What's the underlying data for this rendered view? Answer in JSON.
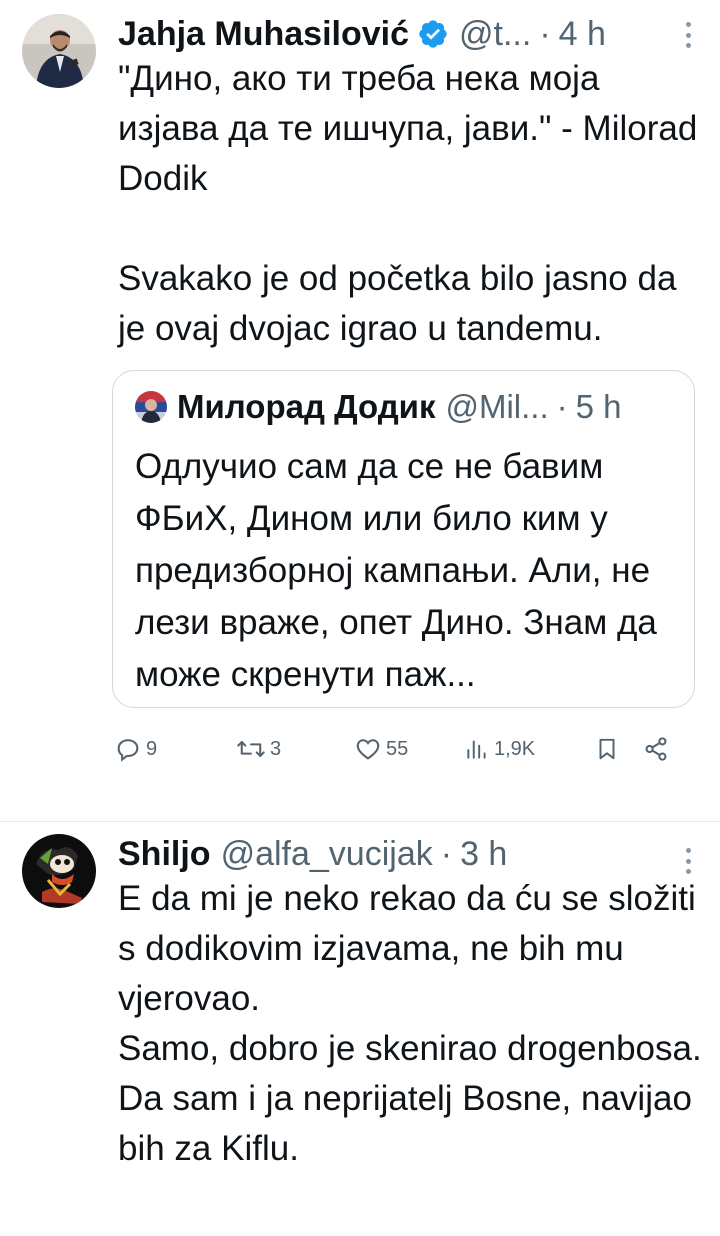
{
  "tweets": [
    {
      "author": {
        "name": "Jahja Muhasilović",
        "handle": "@t...",
        "verified": true
      },
      "time": "4 h",
      "dot": "·",
      "text": "\"Дино, ако ти треба нека моја изјава да те ишчупа, јави.\" - Milorad Dodik\n\nSvakako je od početka bilo jasno da je ovaj dvojac igrao u tandemu.",
      "quote": {
        "name": "Милорад Додик",
        "handle": "@Mil...",
        "time": "5 h",
        "text": "Одлучио сам да се не бавим ФБиХ, Дином или било ким у предизборној кампањи. Али, не лези враже, опет Дино. Знам да може скренути паж..."
      },
      "stats": {
        "replies": "9",
        "reposts": "3",
        "likes": "55",
        "views": "1,9K"
      }
    },
    {
      "author": {
        "name": "Shiljo",
        "handle": "@alfa_vucijak",
        "verified": false
      },
      "time": "3 h",
      "dot": "·",
      "text": "E da mi je neko rekao da ću se složiti s dodikovim izjavama, ne bih mu vjerovao.\nSamo, dobro je skenirao drogenbosa. Da sam i ja neprijatelj Bosne, navijao bih za Kiflu."
    }
  ],
  "colors": {
    "verified": "#1d9bf0",
    "secondary_text": "#536471",
    "border": "#cfd9de"
  },
  "icons": {
    "reply": "reply-icon",
    "repost": "repost-icon",
    "like": "heart-icon",
    "views": "views-icon",
    "bookmark": "bookmark-icon",
    "share": "share-icon"
  }
}
